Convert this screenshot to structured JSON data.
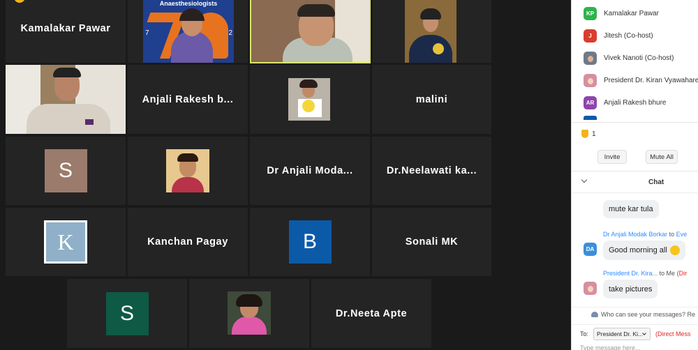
{
  "gallery": {
    "tiles": [
      {
        "name": "Kamalakar Pawar"
      },
      {
        "name": "Anjali Rakesh b..."
      },
      {
        "name": "malini"
      },
      {
        "name": "Dr  Anjali  Moda..."
      },
      {
        "name": "Dr.Neelawati   ka..."
      },
      {
        "name": "Kanchan Pagay"
      },
      {
        "name": "Sonali MK"
      },
      {
        "name": "Dr.Neeta Apte"
      }
    ],
    "avatars": {
      "s1": "S",
      "k": "K",
      "b": "B",
      "s2": "S"
    },
    "banner_text": "Anaesthesiologists",
    "banner_left": "7",
    "banner_right": "2"
  },
  "participants": {
    "list": [
      {
        "initials": "KP",
        "name": "Kamalakar Pawar",
        "color": "#2fb24b"
      },
      {
        "initials": "J",
        "name": "Jitesh (Co-host)",
        "color": "#d93d2d"
      },
      {
        "initials": "",
        "name": "Vivek Nanoti (Co-host)",
        "color": "#6c7a8a"
      },
      {
        "initials": "",
        "name": "President Dr. Kiran Vyawahare",
        "color": "#d78fa0"
      },
      {
        "initials": "AR",
        "name": "Anjali Rakesh bhure",
        "color": "#8e44ad"
      }
    ],
    "raised_hands": "1",
    "invite_label": "Invite",
    "mute_all_label": "Mute All"
  },
  "chat": {
    "title": "Chat",
    "messages": [
      {
        "text": "mute kar tula"
      },
      {
        "sender": "Dr Anjali Modak Borkar",
        "to_word": "to",
        "recipient": "Eve",
        "initials": "DA",
        "text": "Good morning all"
      },
      {
        "sender": "President Dr. Kira...",
        "to_word": "to Me",
        "tag": "(Dir",
        "text": "take pictures"
      }
    ],
    "who_can_see": "Who can see your messages? Re",
    "to_label": "To:",
    "to_value": "President Dr. Ki...",
    "direct_tag": "(Direct Mess",
    "input_placeholder": "Type message here..."
  },
  "colors": {
    "stage_bg": "#1a1a1a",
    "tile_bg": "#242424",
    "active_border": "#d9e56b",
    "link_blue": "#2d8cff"
  }
}
